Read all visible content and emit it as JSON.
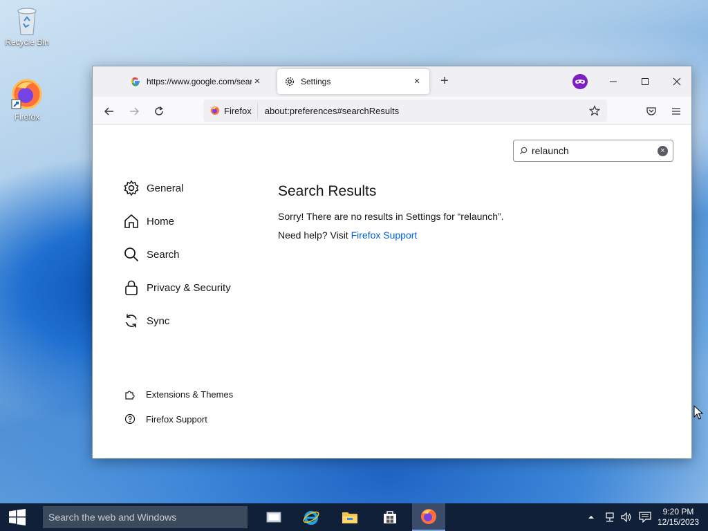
{
  "desktop": {
    "icons": [
      {
        "label": "Recycle Bin",
        "icon": "recycle-bin-icon"
      },
      {
        "label": "Firefox",
        "icon": "firefox-icon"
      }
    ]
  },
  "browser": {
    "tabs": [
      {
        "title": "https://www.google.com/search",
        "icon": "google-icon",
        "active": false
      },
      {
        "title": "Settings",
        "icon": "gear-icon",
        "active": true
      }
    ],
    "urlbar": {
      "identity_label": "Firefox",
      "url": "about:preferences#searchResults"
    },
    "settings_search": {
      "value": "relaunch"
    },
    "categories": [
      {
        "label": "General",
        "icon": "gear-icon"
      },
      {
        "label": "Home",
        "icon": "home-icon"
      },
      {
        "label": "Search",
        "icon": "search-icon"
      },
      {
        "label": "Privacy & Security",
        "icon": "lock-icon"
      },
      {
        "label": "Sync",
        "icon": "sync-icon"
      }
    ],
    "footer_links": [
      {
        "label": "Extensions & Themes",
        "icon": "puzzle-icon"
      },
      {
        "label": "Firefox Support",
        "icon": "help-icon"
      }
    ],
    "results": {
      "title": "Search Results",
      "message": "Sorry! There are no results in Settings for “relaunch”.",
      "help_prefix": "Need help? Visit ",
      "help_link": "Firefox Support"
    },
    "colors": {
      "link": "#0061e0",
      "private_badge": "#7b1fc2"
    }
  },
  "taskbar": {
    "search_placeholder": "Search the web and Windows",
    "apps": [
      "task-view-icon",
      "internet-explorer-icon",
      "file-explorer-icon",
      "store-icon",
      "firefox-icon"
    ],
    "clock": {
      "time": "9:20 PM",
      "date": "12/15/2023"
    }
  }
}
